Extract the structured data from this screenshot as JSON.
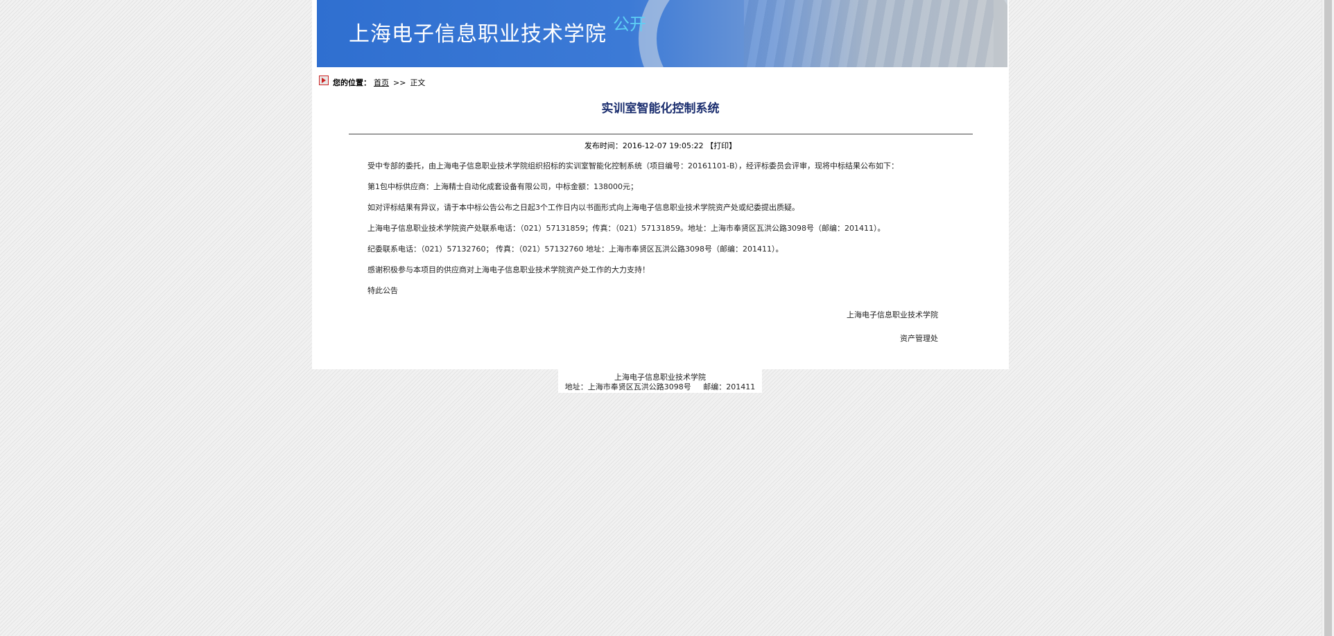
{
  "banner": {
    "title": "上海电子信息职业技术学院",
    "badge": "公开"
  },
  "breadcrumb": {
    "label": "您的位置：",
    "home": "首页",
    "separator": ">>",
    "current": "正文"
  },
  "article": {
    "title": "实训室智能化控制系统",
    "publish_label": "发布时间：",
    "publish_time": "2016-12-07 19:05:22",
    "print_label": "【打印】",
    "paragraphs": [
      "受中专部的委托，由上海电子信息职业技术学院组织招标的实训室智能化控制系统（项目编号：20161101-B），经评标委员会评审，现将中标结果公布如下：",
      "第1包中标供应商：上海精士自动化成套设备有限公司，中标金额：138000元；",
      "如对评标结果有异议，请于本中标公告公布之日起3个工作日内以书面形式向上海电子信息职业技术学院资产处或纪委提出质疑。",
      "上海电子信息职业技术学院资产处联系电话：（021）57131859；传真：（021）57131859。地址：上海市奉贤区瓦洪公路3098号（邮编：201411）。",
      "纪委联系电话：（021）57132760；  传真：（021）57132760 地址：上海市奉贤区瓦洪公路3098号（邮编：201411）。",
      "感谢积极参与本项目的供应商对上海电子信息职业技术学院资产处工作的大力支持！",
      "特此公告"
    ],
    "signature_org": "上海电子信息职业技术学院",
    "signature_dept": "资产管理处"
  },
  "footer": {
    "line1": "上海电子信息职业技术学院",
    "line2": "地址：上海市奉贤区瓦洪公路3098号     邮编：201411"
  }
}
